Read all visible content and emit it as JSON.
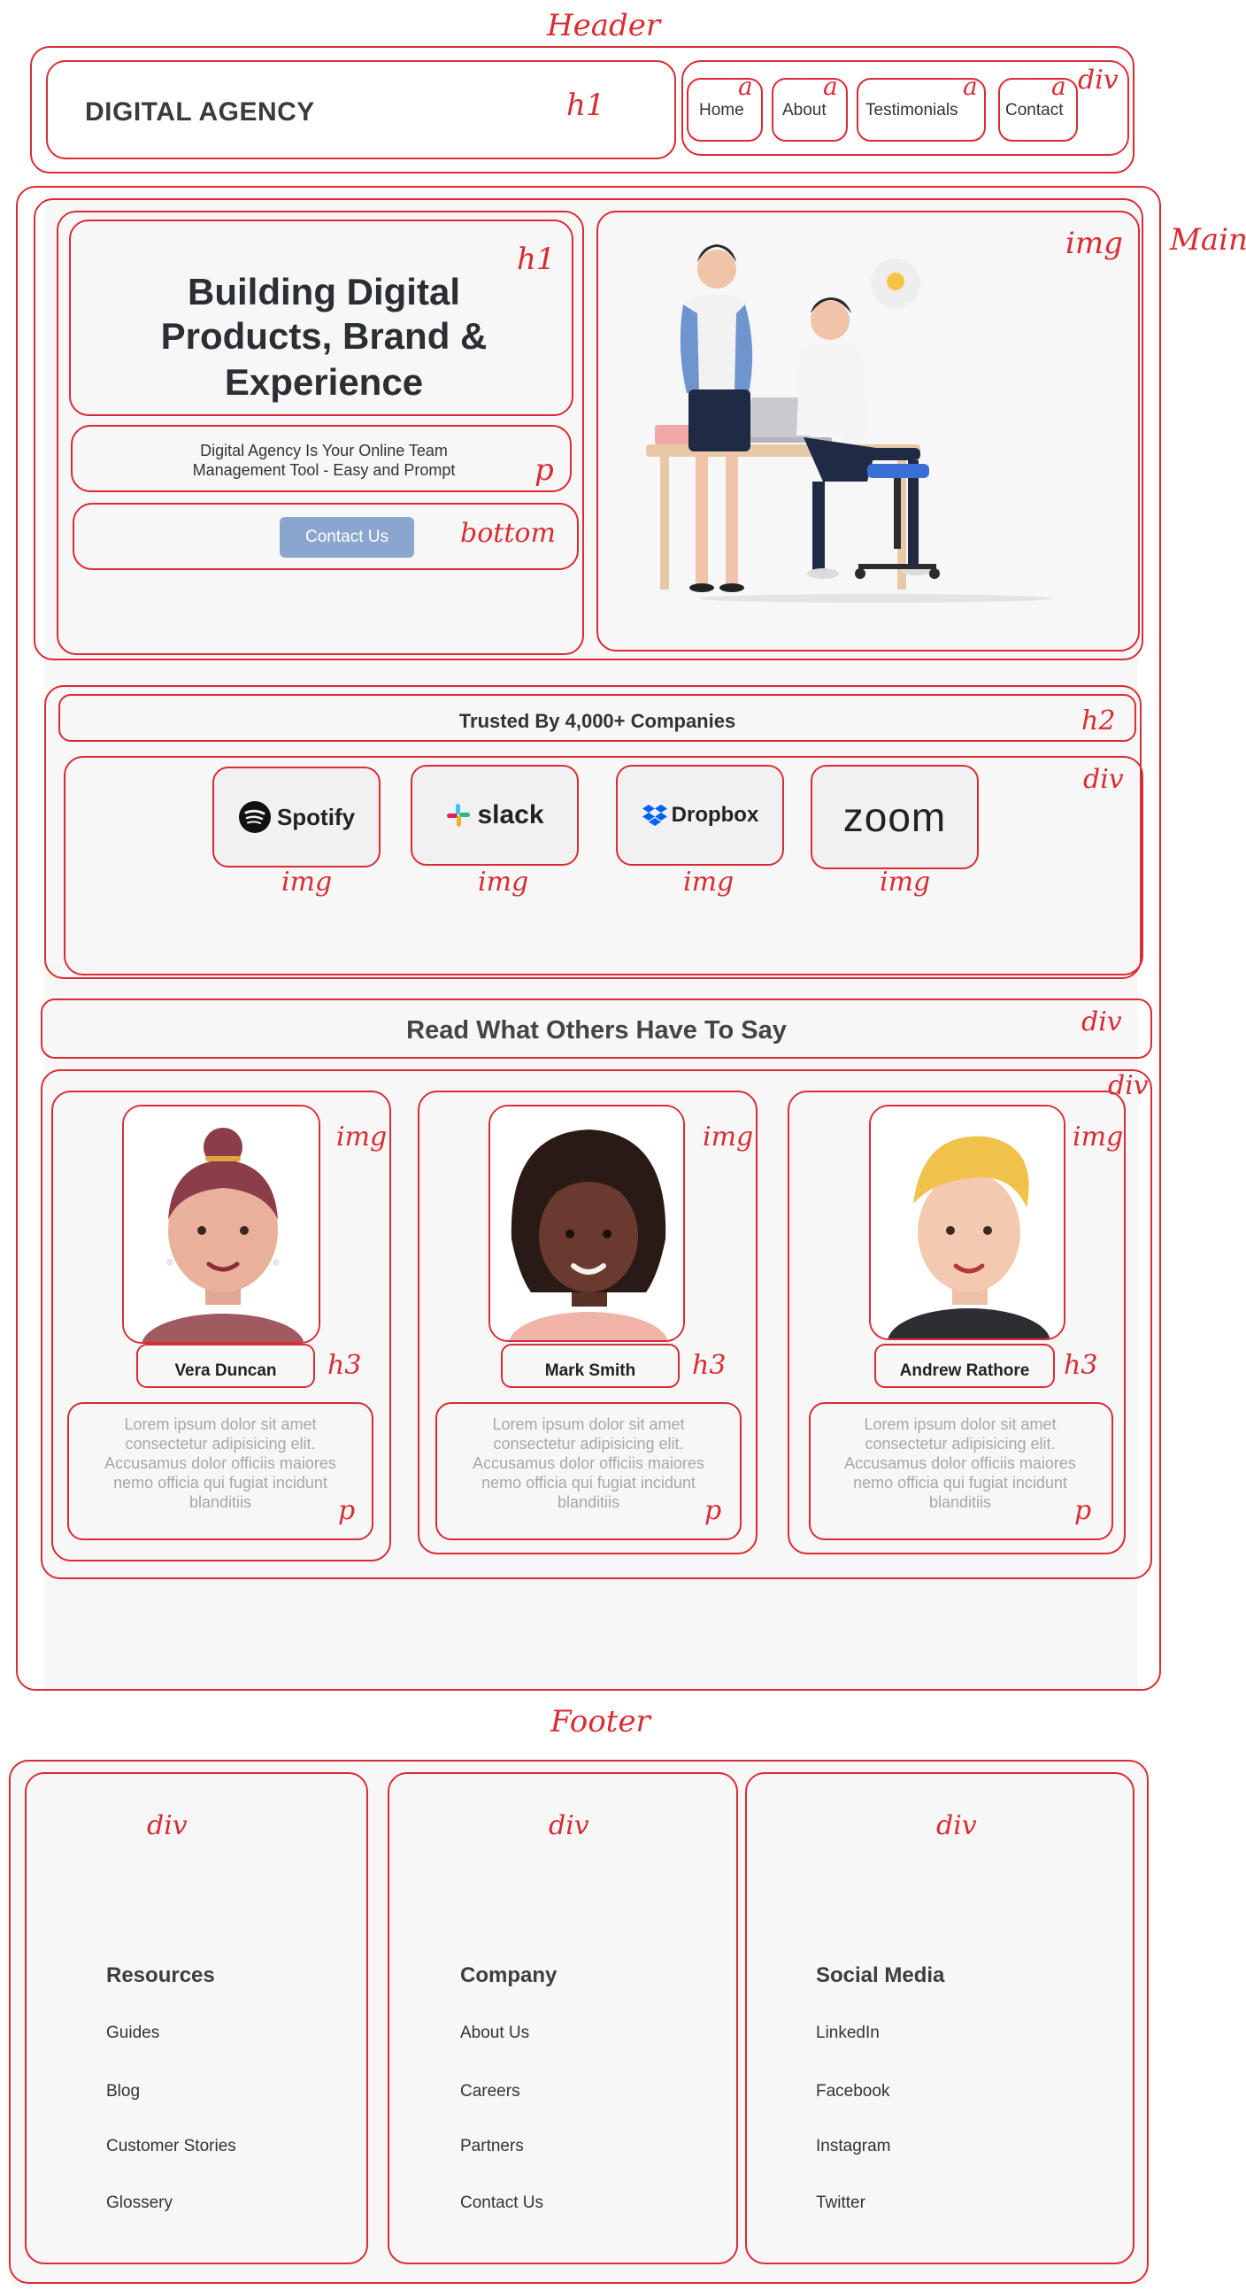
{
  "annotations": {
    "header": "Header",
    "main": "Main",
    "footer": "Footer",
    "h1": "h1",
    "a": "a",
    "div": "div",
    "img": "img",
    "p": "p",
    "bottom": "bottom",
    "h2": "h2",
    "h3": "h3"
  },
  "header": {
    "brand": "DIGITAL AGENCY",
    "nav": [
      "Home",
      "About",
      "Testimonials",
      "Contact"
    ]
  },
  "hero": {
    "title_lines": [
      "Building Digital",
      "Products, Brand &",
      "Experience"
    ],
    "subtitle_lines": [
      "Digital Agency Is Your Online Team",
      "Management Tool - Easy and Prompt"
    ],
    "cta": "Contact Us",
    "illustration": "office-teamwork-illustration"
  },
  "trusted": {
    "heading": "Trusted By 4,000+ Companies",
    "logos": [
      "Spotify",
      "slack",
      "Dropbox",
      "zoom"
    ]
  },
  "testimonials": {
    "heading": "Read What Others Have To Say",
    "items": [
      {
        "name": "Vera Duncan",
        "text_lines": [
          "Lorem ipsum dolor sit amet",
          "consectetur adipisicing elit.",
          "Accusamus dolor officiis maiores",
          "nemo officia qui fugiat incidunt",
          "blanditiis"
        ]
      },
      {
        "name": "Mark Smith",
        "text_lines": [
          "Lorem ipsum dolor sit amet",
          "consectetur adipisicing elit.",
          "Accusamus dolor officiis maiores",
          "nemo officia qui fugiat incidunt",
          "blanditiis"
        ]
      },
      {
        "name": "Andrew Rathore",
        "text_lines": [
          "Lorem ipsum dolor sit amet",
          "consectetur adipisicing elit.",
          "Accusamus dolor officiis maiores",
          "nemo officia qui fugiat incidunt",
          "blanditiis"
        ]
      }
    ]
  },
  "footer": {
    "columns": [
      {
        "heading": "Resources",
        "links": [
          "Guides",
          "Blog",
          "Customer Stories",
          "Glossery"
        ]
      },
      {
        "heading": "Company",
        "links": [
          "About Us",
          "Careers",
          "Partners",
          "Contact Us"
        ]
      },
      {
        "heading": "Social Media",
        "links": [
          "LinkedIn",
          "Facebook",
          "Instagram",
          "Twitter"
        ]
      }
    ]
  },
  "colors": {
    "annotation_red": "#d92c33",
    "cta_blue": "#8aa6cf",
    "panel_grey": "#f7f7f8"
  }
}
